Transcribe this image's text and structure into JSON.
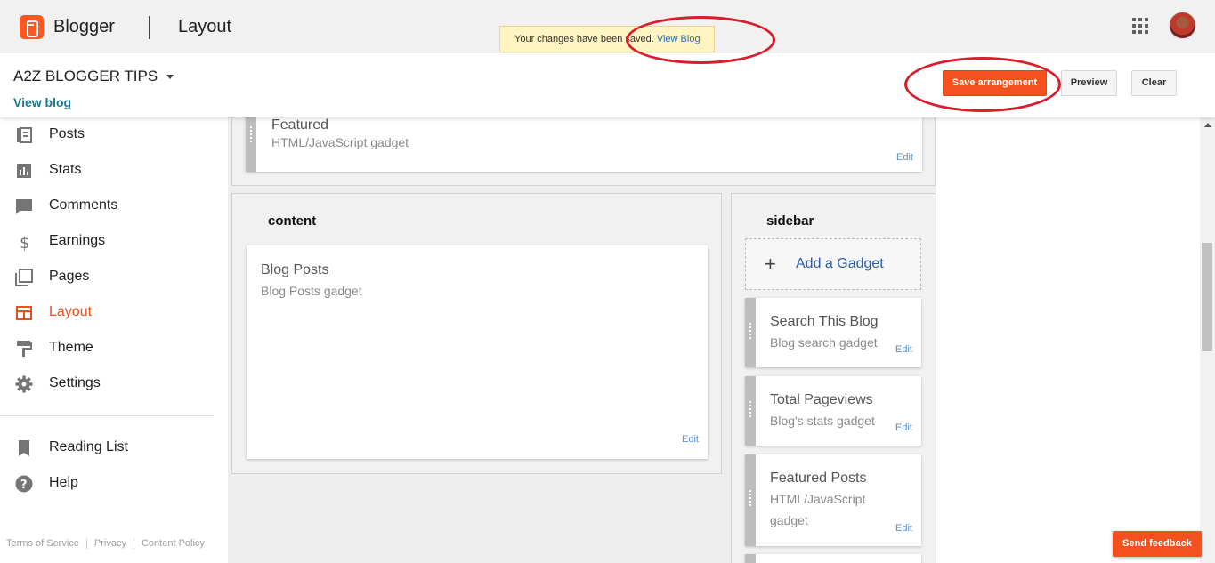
{
  "header": {
    "brand": "Blogger",
    "page_title": "Layout",
    "apps_icon": "apps-grid-icon",
    "avatar": "user-avatar"
  },
  "toast": {
    "message": "Your changes have been saved.",
    "link": "View Blog"
  },
  "subbar": {
    "blog_name": "A2Z BLOGGER TIPS",
    "view_blog": "View blog",
    "save_label": "Save arrangement",
    "preview_label": "Preview",
    "clear_label": "Clear"
  },
  "nav": {
    "items": [
      {
        "label": "Posts",
        "icon": "posts-icon"
      },
      {
        "label": "Stats",
        "icon": "stats-icon"
      },
      {
        "label": "Comments",
        "icon": "comments-icon"
      },
      {
        "label": "Earnings",
        "icon": "dollar-icon"
      },
      {
        "label": "Pages",
        "icon": "pages-icon"
      },
      {
        "label": "Layout",
        "icon": "layout-icon",
        "active": true
      },
      {
        "label": "Theme",
        "icon": "paint-roller-icon"
      },
      {
        "label": "Settings",
        "icon": "gear-icon"
      }
    ],
    "secondary": [
      {
        "label": "Reading List",
        "icon": "bookmark-icon"
      },
      {
        "label": "Help",
        "icon": "help-icon"
      }
    ],
    "footer": [
      "Terms of Service",
      "Privacy",
      "Content Policy"
    ]
  },
  "layout": {
    "top_gadget": {
      "title": "Featured",
      "subtitle": "HTML/JavaScript gadget",
      "edit": "Edit"
    },
    "content": {
      "title": "content",
      "gadgets": [
        {
          "title": "Blog Posts",
          "subtitle": "Blog Posts gadget",
          "edit": "Edit"
        }
      ]
    },
    "sidebar": {
      "title": "sidebar",
      "add_gadget": "Add a Gadget",
      "gadgets": [
        {
          "title": "Search This Blog",
          "subtitle": "Blog search gadget",
          "edit": "Edit"
        },
        {
          "title": "Total Pageviews",
          "subtitle": "Blog's stats gadget",
          "edit": "Edit"
        },
        {
          "title": "Featured Posts",
          "subtitle": "HTML/JavaScript gadget",
          "edit": "Edit"
        }
      ]
    }
  },
  "feedback": "Send feedback",
  "colors": {
    "accent": "#f4511e",
    "annotation": "#d81e2c",
    "link": "#2b5ea7"
  }
}
